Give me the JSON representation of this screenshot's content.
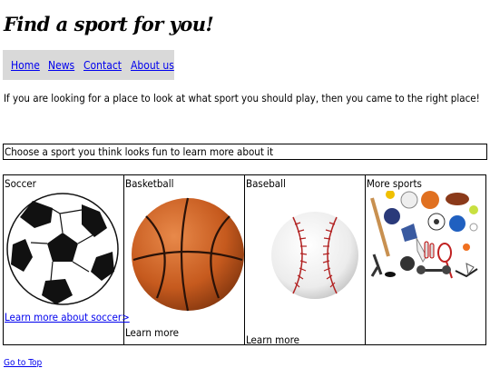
{
  "page": {
    "title": "Find a sport for you!",
    "intro": "If you are looking for a place to look at what sport you should play, then you came to the right place!",
    "prompt": "Choose a sport you think looks fun to learn more about it",
    "back_to_top": "Go to Top"
  },
  "nav": {
    "items": [
      {
        "label": "Home"
      },
      {
        "label": "News"
      },
      {
        "label": "Contact"
      },
      {
        "label": "About us"
      }
    ]
  },
  "sports": [
    {
      "title": "Soccer",
      "link": "Learn more about soccer>",
      "icon": "soccer-ball-icon"
    },
    {
      "title": "Basketball",
      "link": "Learn more",
      "icon": "basketball-icon"
    },
    {
      "title": "Baseball",
      "link": "Learn more",
      "icon": "baseball-icon"
    },
    {
      "title": "More sports",
      "icon": "sports-equipment-collage-icon"
    }
  ],
  "colors": {
    "link": "#0000ee",
    "nav_background": "#d9d9d9",
    "basketball": "#d2691e",
    "baseball_stitch": "#b22222"
  }
}
